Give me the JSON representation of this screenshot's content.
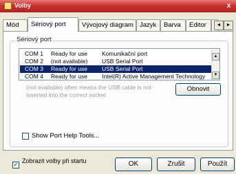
{
  "window": {
    "title": "Volby",
    "close_symbol": "x"
  },
  "tabs": [
    {
      "label": "Mód",
      "active": false
    },
    {
      "label": "Sériový port",
      "active": true
    },
    {
      "label": "Vývojový diagram",
      "active": false
    },
    {
      "label": "Jazyk",
      "active": false
    },
    {
      "label": "Barva",
      "active": false
    },
    {
      "label": "Editor",
      "active": false
    },
    {
      "label": "S",
      "active": false
    }
  ],
  "tab_scroll": {
    "left": "◄",
    "right": "►"
  },
  "serial_port": {
    "group_label": "Sériový port",
    "ports": [
      {
        "port": "COM 1",
        "status": "Ready for use",
        "description": "Komunikační port",
        "selected": false
      },
      {
        "port": "COM 2",
        "status": "(not available)",
        "description": "USB Serial Port",
        "selected": false
      },
      {
        "port": "COM 3",
        "status": "Ready for use",
        "description": "USB Serial Port",
        "selected": true
      },
      {
        "port": "COM 4",
        "status": "Ready for use",
        "description": "Intel(R) Active Management Technology",
        "selected": false
      }
    ],
    "scroll_up": "▲",
    "scroll_down": "▼",
    "hint": "(not available) often means the USB cable is not inserted into the correct socket",
    "refresh_label": "Obnovit",
    "show_help_tools_label": "Show Port Help Tools...",
    "show_help_tools_checked": false
  },
  "footer": {
    "show_at_start_label": "Zobrazit volby při startu",
    "show_at_start_checked": true,
    "check_mark": "✔",
    "ok_label": "OK",
    "cancel_label": "Zrušit",
    "apply_label": "Použít"
  },
  "colors": {
    "titlebar": "#b42220",
    "selection": "#0a246a",
    "panel": "#fcfcfe",
    "dialog": "#ece9d8"
  }
}
